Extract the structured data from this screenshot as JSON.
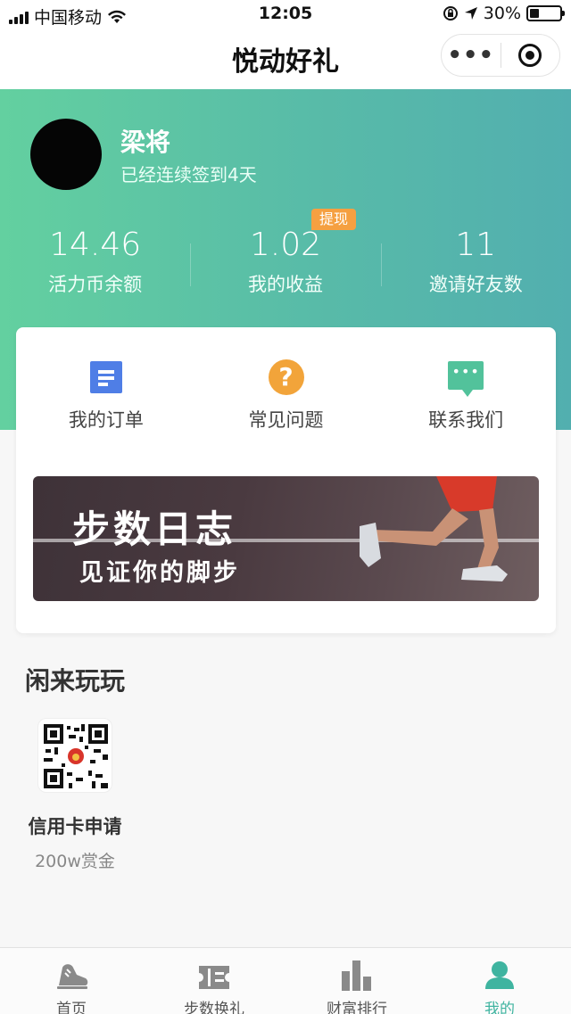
{
  "status_bar": {
    "carrier": "中国移动",
    "time": "12:05",
    "battery": "30%"
  },
  "nav": {
    "title": "悦动好礼",
    "more_label": "•••"
  },
  "profile": {
    "name": "梁将",
    "checkin_text": "已经连续签到4天"
  },
  "stats": [
    {
      "value": "14.46",
      "label": "活力币余额"
    },
    {
      "value": "1.02",
      "label": "我的收益"
    },
    {
      "value": "11",
      "label": "邀请好友数"
    }
  ],
  "withdraw_badge": "提现",
  "shortcuts": [
    {
      "label": "我的订单",
      "icon": "document-icon"
    },
    {
      "label": "常见问题",
      "icon": "question-icon"
    },
    {
      "label": "联系我们",
      "icon": "chat-icon"
    }
  ],
  "banner": {
    "title": "步数日志",
    "subtitle": "见证你的脚步"
  },
  "section": {
    "title": "闲来玩玩",
    "items": [
      {
        "name": "信用卡申请",
        "desc": "200w赏金",
        "icon": "qr-code-icon"
      }
    ]
  },
  "tabbar": [
    {
      "label": "首页",
      "icon": "sneaker-icon",
      "active": false
    },
    {
      "label": "步数换礼",
      "icon": "ticket-icon",
      "active": false
    },
    {
      "label": "财富排行",
      "icon": "bar-chart-icon",
      "active": false
    },
    {
      "label": "我的",
      "icon": "person-icon",
      "active": true
    }
  ],
  "colors": {
    "accent": "#3fb4a0",
    "hero_start": "#63d0a0",
    "hero_end": "#52afaf",
    "badge": "#f5a041"
  }
}
